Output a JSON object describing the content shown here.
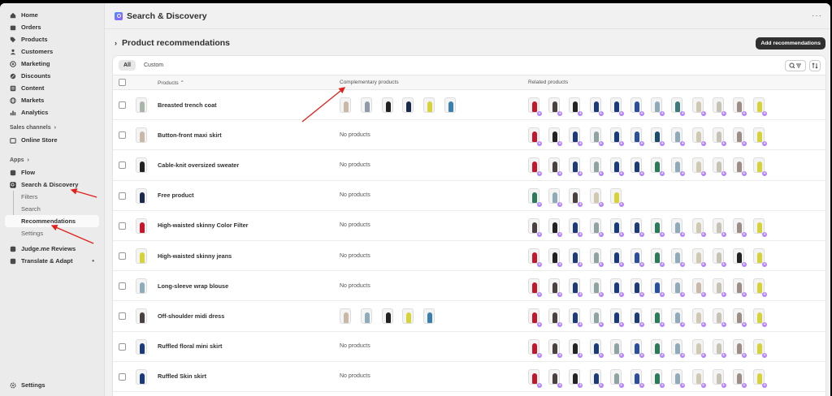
{
  "sidebar": {
    "items": [
      {
        "label": "Home",
        "icon": "home-icon"
      },
      {
        "label": "Orders",
        "icon": "orders-icon"
      },
      {
        "label": "Products",
        "icon": "tag-icon"
      },
      {
        "label": "Customers",
        "icon": "person-icon"
      },
      {
        "label": "Marketing",
        "icon": "target-icon"
      },
      {
        "label": "Discounts",
        "icon": "discount-icon"
      },
      {
        "label": "Content",
        "icon": "content-icon"
      },
      {
        "label": "Markets",
        "icon": "globe-icon"
      },
      {
        "label": "Analytics",
        "icon": "chart-icon"
      }
    ],
    "sales_channels_label": "Sales channels",
    "online_store": "Online Store",
    "apps_label": "Apps",
    "flow": "Flow",
    "search_discovery": "Search & Discovery",
    "sub_items": [
      "Filters",
      "Search",
      "Recommendations",
      "Settings"
    ],
    "judgeme": "Judge.me Reviews",
    "translate": "Translate & Adapt",
    "settings": "Settings"
  },
  "header": {
    "app_title": "Search & Discovery",
    "page_title": "Product recommendations",
    "add_button": "Add recommendations"
  },
  "tabs": [
    "All",
    "Custom"
  ],
  "table": {
    "columns": [
      "Products",
      "Complementary products",
      "Related products"
    ],
    "no_products": "No products",
    "rows": [
      {
        "name": "Breasted trench coat",
        "thumb": "#a8b5a8",
        "comp": [
          "#c9b8a8",
          "#8f9aa8",
          "#222222",
          "#1b2a4a",
          "#d6d23a",
          "#3b7fae"
        ],
        "rel": [
          "#c4172c",
          "#4a4040",
          "#222222",
          "#1b3a7a",
          "#1b3a7a",
          "#2b4fa0",
          "#8faab8",
          "#3b7b7b",
          "#d0c8b0",
          "#c7c2b6",
          "#9c8e86",
          "#d6d23a"
        ]
      },
      {
        "name": "Button-front maxi skirt",
        "thumb": "#c9b8a8",
        "comp": [],
        "rel": [
          "#c4172c",
          "#222222",
          "#1b3a7a",
          "#8fa3a0",
          "#1b3a7a",
          "#2b4fa0",
          "#1b4a6a",
          "#8faab8",
          "#d0c8b0",
          "#c7c2b6",
          "#9c8e86",
          "#d6d23a"
        ]
      },
      {
        "name": "Cable-knit oversized sweater",
        "thumb": "#222222",
        "comp": [],
        "rel": [
          "#c4172c",
          "#4a4040",
          "#1b3a7a",
          "#8fa3a0",
          "#1b3a7a",
          "#1b3a7a",
          "#2b7a5a",
          "#8faab8",
          "#d0c8b0",
          "#c7c2b6",
          "#9c8e86",
          "#d6d23a"
        ]
      },
      {
        "name": "Free product",
        "thumb": "#1b2a4a",
        "comp": [],
        "rel": [
          "#2b7a5a",
          "#8faab8",
          "#4a4040",
          "#d0c8b0",
          "#d6d23a"
        ]
      },
      {
        "name": "High-waisted skinny Color Filter",
        "thumb": "#c4172c",
        "comp": [],
        "rel": [
          "#4a4040",
          "#222222",
          "#1b3a7a",
          "#8fa3a0",
          "#1b3a7a",
          "#1b3a7a",
          "#2b7a5a",
          "#8faab8",
          "#d0c8b0",
          "#c7c2b6",
          "#9c8e86",
          "#d6d23a"
        ]
      },
      {
        "name": "High-waisted skinny jeans",
        "thumb": "#d6d23a",
        "comp": [],
        "rel": [
          "#c4172c",
          "#222222",
          "#1b3a7a",
          "#8fa3a0",
          "#1b3a7a",
          "#2b4fa0",
          "#2b7a5a",
          "#8faab8",
          "#d0c8b0",
          "#c7c2b6",
          "#222222",
          "#d6d23a"
        ]
      },
      {
        "name": "Long-sleeve wrap blouse",
        "thumb": "#8faab8",
        "comp": [],
        "rel": [
          "#c4172c",
          "#4a4040",
          "#1b3a7a",
          "#8fa3a0",
          "#1b3a7a",
          "#1b3a7a",
          "#2b4fa0",
          "#8faab8",
          "#c9b8a8",
          "#c7c2b6",
          "#9c8e86",
          "#d6d23a"
        ]
      },
      {
        "name": "Off-shoulder midi dress",
        "thumb": "#4a4040",
        "comp": [
          "#c9b8a8",
          "#8faab8",
          "#222222",
          "#d6d23a",
          "#3b7fae"
        ],
        "rel": [
          "#c4172c",
          "#4a4040",
          "#1b3a7a",
          "#8fa3a0",
          "#1b3a7a",
          "#1b3a7a",
          "#2b7a5a",
          "#8faab8",
          "#d0c8b0",
          "#c7c2b6",
          "#9c8e86",
          "#d6d23a"
        ]
      },
      {
        "name": "Ruffled floral mini skirt",
        "thumb": "#1b3a7a",
        "comp": [],
        "rel": [
          "#c4172c",
          "#4a4040",
          "#222222",
          "#1b3a7a",
          "#8fa3a0",
          "#2b4fa0",
          "#2b7a5a",
          "#8faab8",
          "#d0c8b0",
          "#c7c2b6",
          "#9c8e86",
          "#d6d23a"
        ]
      },
      {
        "name": "Ruffled Skin skirt",
        "thumb": "#1b3a7a",
        "comp": [],
        "rel": [
          "#c4172c",
          "#4a4040",
          "#222222",
          "#1b3a7a",
          "#8fa3a0",
          "#2b4fa0",
          "#2b7a5a",
          "#8faab8",
          "#d0c8b0",
          "#c7c2b6",
          "#9c8e86",
          "#d6d23a"
        ]
      }
    ]
  },
  "colors": {
    "accent": "#b583ff",
    "annotation": "#e0201b",
    "dark_button": "#303030"
  }
}
